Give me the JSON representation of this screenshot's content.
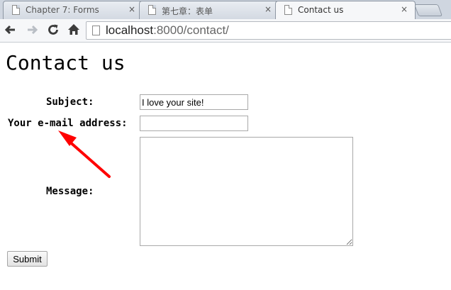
{
  "browser": {
    "tabs": [
      {
        "title": "Chapter 7: Forms",
        "active": false
      },
      {
        "title": "第七章：表单",
        "active": false
      },
      {
        "title": "Contact us",
        "active": true
      }
    ],
    "close_glyph": "×",
    "url_host": "localhost",
    "url_rest": ":8000/contact/",
    "icons": {
      "back": "arrow-left-icon",
      "forward": "arrow-right-icon",
      "reload": "reload-icon",
      "home": "home-icon"
    }
  },
  "page": {
    "heading": "Contact us",
    "form": {
      "subject_label": "Subject:",
      "subject_value": "I love your site!",
      "email_label": "Your e-mail address:",
      "email_value": "",
      "message_label": "Message:",
      "message_value": "",
      "submit_label": "Submit"
    }
  },
  "annotation": {
    "arrow_color": "#ff0000"
  }
}
